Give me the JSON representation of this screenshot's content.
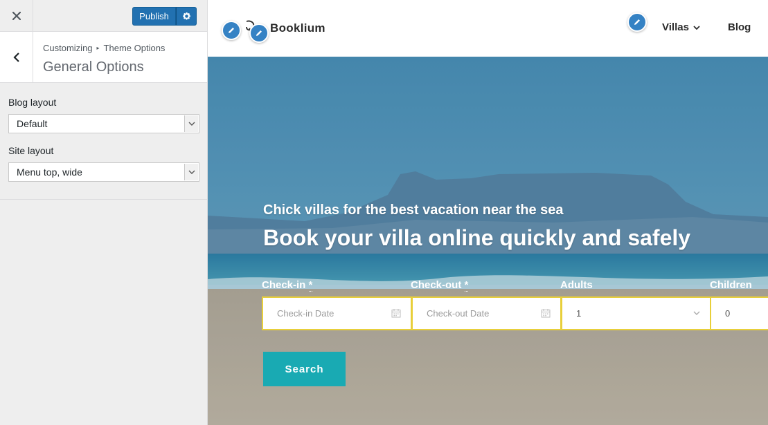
{
  "customizer": {
    "publish_label": "Publish",
    "breadcrumb": [
      "Customizing",
      "Theme Options"
    ],
    "breadcrumb_separator": "▸",
    "section_title": "General Options",
    "controls": {
      "blog_layout": {
        "label": "Blog layout",
        "value": "Default"
      },
      "site_layout": {
        "label": "Site layout",
        "value": "Menu top, wide"
      }
    },
    "accent": "#2271b1"
  },
  "site": {
    "title": "Booklium",
    "nav": {
      "villas": "Villas",
      "blog": "Blog"
    },
    "hero": {
      "subtitle": "Chick villas for the best vacation near the sea",
      "title": "Book your villa online quickly and safely"
    },
    "search_form": {
      "check_in": {
        "label": "Check-in",
        "required_mark": "*",
        "placeholder": "Check-in Date"
      },
      "check_out": {
        "label": "Check-out",
        "required_mark": "*",
        "placeholder": "Check-out Date"
      },
      "adults": {
        "label": "Adults",
        "value": "1"
      },
      "children": {
        "label": "Children",
        "value": "0"
      },
      "submit_label": "Search"
    },
    "colors": {
      "button": "#19aab3",
      "field_border": "#e8cf3a"
    }
  }
}
